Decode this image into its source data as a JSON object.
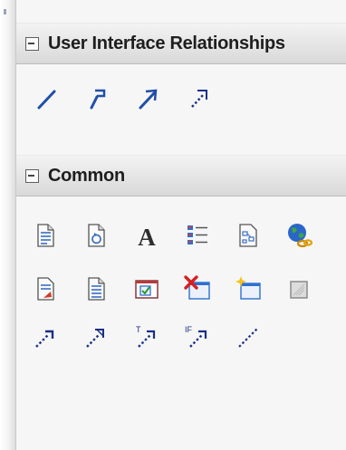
{
  "toolbox": {
    "sections": [
      {
        "title": "User Interface Relationships",
        "collapsed": false,
        "items": [
          {
            "icon": "ui-link-line-icon"
          },
          {
            "icon": "ui-navigate-connector-icon"
          },
          {
            "icon": "ui-arrow-connector-icon"
          },
          {
            "icon": "ui-dashed-arrow-connector-icon"
          }
        ]
      },
      {
        "title": "Common",
        "collapsed": false,
        "rows": [
          [
            {
              "icon": "document-icon"
            },
            {
              "icon": "document-refresh-icon"
            },
            {
              "icon": "text-a-icon"
            },
            {
              "icon": "list-items-icon"
            },
            {
              "icon": "diagram-reference-icon"
            },
            {
              "icon": "globe-link-icon"
            }
          ],
          [
            {
              "icon": "document-red-mark-icon"
            },
            {
              "icon": "document-lines-icon"
            },
            {
              "icon": "checkbox-window-icon"
            },
            {
              "icon": "delete-window-icon"
            },
            {
              "icon": "new-window-sparkle-icon"
            },
            {
              "icon": "boundary-box-icon"
            }
          ],
          [
            {
              "icon": "dashed-arrow-icon"
            },
            {
              "icon": "dashed-arrow-diagonal-icon"
            },
            {
              "icon": "trace-dashed-arrow-icon"
            },
            {
              "icon": "if-dashed-arrow-icon"
            },
            {
              "icon": "dashed-line-icon"
            }
          ]
        ]
      }
    ]
  },
  "colors": {
    "connector_blue": "#1f4fa8",
    "connector_navy": "#1a2f8a",
    "header_text": "#1e1e1e"
  }
}
